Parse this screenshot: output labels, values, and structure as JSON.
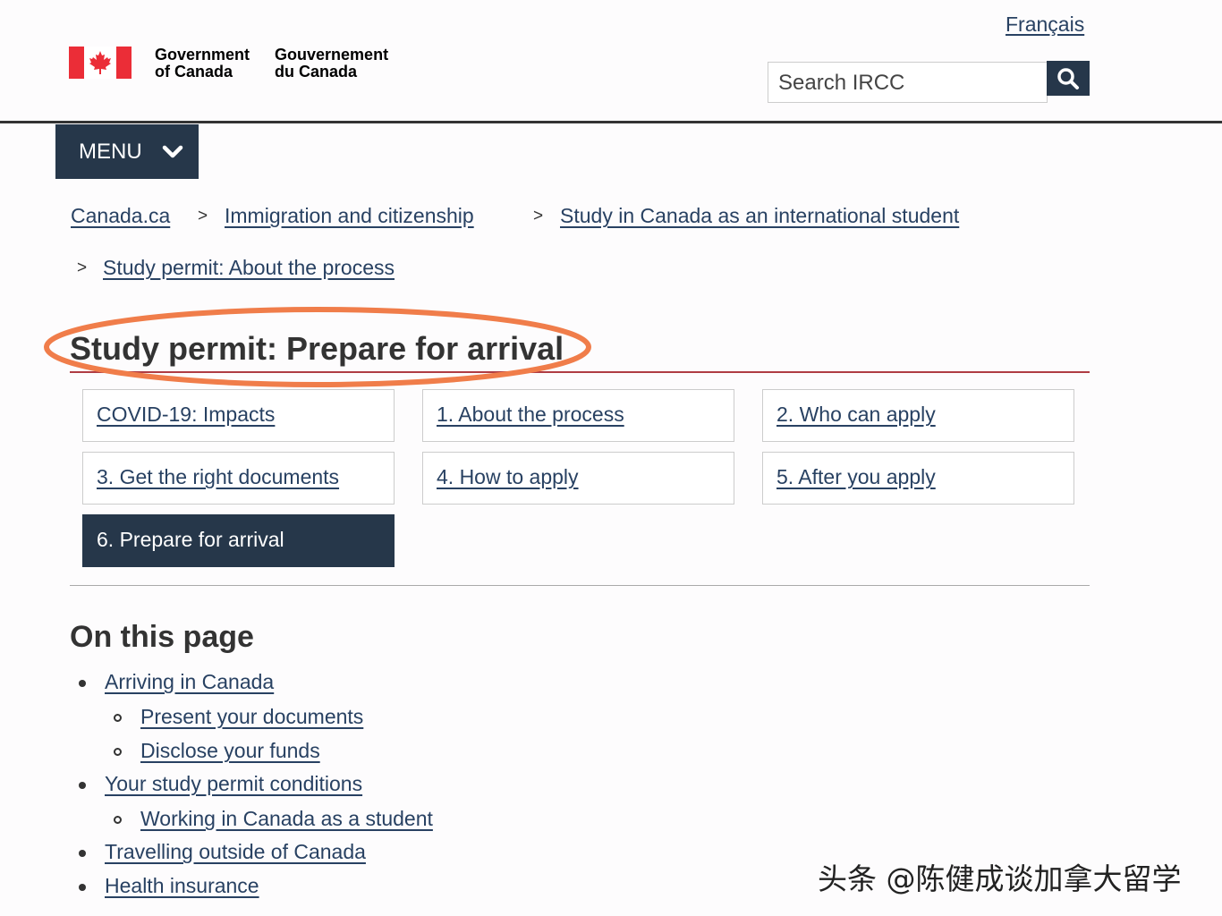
{
  "header": {
    "language_toggle": "Français",
    "wordmark_en": [
      "Government",
      "of Canada"
    ],
    "wordmark_fr": [
      "Gouvernement",
      "du Canada"
    ],
    "search_placeholder": "Search IRCC",
    "search_icon": "magnifier-icon",
    "flag_icon": "canada-flag-icon"
  },
  "menu": {
    "label": "MENU",
    "icon": "chevron-down-icon"
  },
  "breadcrumbs": [
    "Canada.ca",
    "Immigration and citizenship",
    "Study in Canada as an international student",
    "Study permit: About the process"
  ],
  "breadcrumb_separator": ">",
  "page_title": "Study permit: Prepare for arrival",
  "steps": [
    {
      "label": "COVID-19: Impacts",
      "active": false
    },
    {
      "label": "1. About the process",
      "active": false
    },
    {
      "label": "2. Who can apply",
      "active": false
    },
    {
      "label": "3. Get the right documents",
      "active": false
    },
    {
      "label": "4. How to apply",
      "active": false
    },
    {
      "label": "5. After you apply",
      "active": false
    },
    {
      "label": "6. Prepare for arrival",
      "active": true
    }
  ],
  "on_this_page": {
    "heading": "On this page",
    "items": [
      {
        "label": "Arriving in Canada",
        "level": 1
      },
      {
        "label": "Present your documents",
        "level": 2
      },
      {
        "label": "Disclose your funds",
        "level": 2
      },
      {
        "label": "Your study permit conditions",
        "level": 1
      },
      {
        "label": "Working in Canada as a student",
        "level": 2
      },
      {
        "label": "Travelling outside of Canada",
        "level": 1
      },
      {
        "label": "Health insurance",
        "level": 1
      }
    ]
  },
  "watermark": "头条 @陈健成谈加拿大留学",
  "colors": {
    "navy": "#26374a",
    "link": "#284162",
    "flag_red": "#eb2d37",
    "title_rule": "#af3c43",
    "annotation": "#f07d4a"
  }
}
